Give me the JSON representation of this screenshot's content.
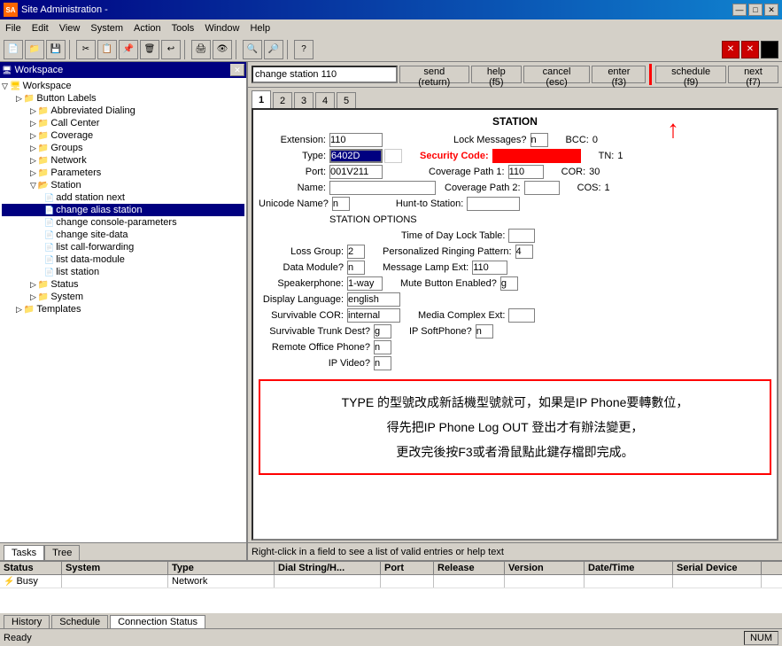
{
  "app": {
    "title": "Site Administration -",
    "icon": "SA"
  },
  "titlebar": {
    "minimize": "—",
    "maximize": "□",
    "close": "✕"
  },
  "menubar": {
    "items": [
      "File",
      "Edit",
      "View",
      "System",
      "Action",
      "Tools",
      "Window",
      "Help"
    ]
  },
  "inner_win": {
    "title": "",
    "close": "✕"
  },
  "workspace": {
    "title": "Workspace"
  },
  "tree": {
    "root": "Workspace",
    "items": [
      {
        "label": "Button Labels",
        "indent": 1,
        "type": "folder",
        "expanded": false
      },
      {
        "label": "Abbreviated Dialing",
        "indent": 2,
        "type": "folder",
        "expanded": false
      },
      {
        "label": "Call Center",
        "indent": 2,
        "type": "folder",
        "expanded": false
      },
      {
        "label": "Coverage",
        "indent": 2,
        "type": "folder",
        "expanded": false
      },
      {
        "label": "Groups",
        "indent": 2,
        "type": "folder",
        "expanded": false
      },
      {
        "label": "Network",
        "indent": 2,
        "type": "folder",
        "expanded": false
      },
      {
        "label": "Parameters",
        "indent": 2,
        "type": "folder",
        "expanded": false
      },
      {
        "label": "Station",
        "indent": 2,
        "type": "folder",
        "expanded": true
      },
      {
        "label": "add station next",
        "indent": 3,
        "type": "doc"
      },
      {
        "label": "change alias station",
        "indent": 3,
        "type": "doc"
      },
      {
        "label": "change console-parameters",
        "indent": 3,
        "type": "doc"
      },
      {
        "label": "change site-data",
        "indent": 3,
        "type": "doc"
      },
      {
        "label": "list call-forwarding",
        "indent": 3,
        "type": "doc"
      },
      {
        "label": "list data-module",
        "indent": 3,
        "type": "doc"
      },
      {
        "label": "list station",
        "indent": 3,
        "type": "doc"
      },
      {
        "label": "Status",
        "indent": 2,
        "type": "folder",
        "expanded": false
      },
      {
        "label": "System",
        "indent": 2,
        "type": "folder",
        "expanded": false
      },
      {
        "label": "Templates",
        "indent": 1,
        "type": "folder",
        "expanded": false
      }
    ]
  },
  "cmdbar": {
    "input_value": "change station 110",
    "send_label": "send (return)",
    "help_label": "help (f5)",
    "cancel_label": "cancel (esc)",
    "enter_label": "enter (f3)",
    "schedule_label": "schedule (f9)",
    "next_label": "next (f7)"
  },
  "tabs": {
    "pages": [
      "1",
      "2",
      "3",
      "4",
      "5"
    ],
    "active": "1"
  },
  "form": {
    "title": "STATION",
    "fields": {
      "extension_label": "Extension:",
      "extension_value": "110",
      "type_label": "Type:",
      "type_value": "6402D",
      "port_label": "Port:",
      "port_value": "001V211",
      "name_label": "Name:",
      "name_value": "",
      "unicode_label": "Unicode Name?",
      "unicode_value": "n",
      "lock_label": "Lock Messages?",
      "lock_value": "n",
      "security_label": "Security Code:",
      "security_value": "",
      "coverage1_label": "Coverage Path 1:",
      "coverage1_value": "110",
      "coverage2_label": "Coverage Path 2:",
      "coverage2_value": "",
      "hunt_label": "Hunt-to Station:",
      "hunt_value": "",
      "bcc_label": "BCC:",
      "bcc_value": "0",
      "tn_label": "TN:",
      "tn_value": "1",
      "cor_label": "COR:",
      "cor_value": "30",
      "cos_label": "COS:",
      "cos_value": "1",
      "section_label": "STATION OPTIONS",
      "tod_label": "Time of Day Lock Table:",
      "tod_value": "",
      "loss_label": "Loss Group:",
      "loss_value": "2",
      "personal_label": "Personalized Ringing Pattern:",
      "personal_value": "4",
      "data_label": "Data Module?",
      "data_value": "n",
      "msg_lamp_label": "Message Lamp Ext:",
      "msg_lamp_value": "110",
      "speaker_label": "Speakerphone:",
      "speaker_value": "1-way",
      "mute_label": "Mute Button Enabled?",
      "mute_value": "g",
      "display_label": "Display Language:",
      "display_value": "english",
      "survivable_cor_label": "Survivable COR:",
      "survivable_cor_value": "internal",
      "media_label": "Media Complex Ext:",
      "media_value": "",
      "survivable_trunk_label": "Survivable Trunk Dest?",
      "survivable_trunk_value": "g",
      "ip_softphone_label": "IP SoftPhone?",
      "ip_softphone_value": "n",
      "remote_label": "Remote Office Phone?",
      "remote_value": "n",
      "ip_video_label": "IP Video?",
      "ip_video_value": "n"
    }
  },
  "annotation": {
    "line1": "TYPE 的型號改成新話機型號就可，如果是IP Phone要轉數位，",
    "line2": "得先把IP Phone Log OUT 登出才有辦法變更，",
    "line3": "更改完後按F3或者滑鼠點此鍵存檔即完成。"
  },
  "status_hint": "Right-click in a field to see a list of valid entries or help text",
  "tasks_tabs": {
    "tasks": "Tasks",
    "tree": "Tree"
  },
  "log_table": {
    "headers": [
      "Status",
      "System",
      "Type",
      "Dial String/H...",
      "Port",
      "Release",
      "Version",
      "Date/Time",
      "Serial Device"
    ],
    "rows": [
      {
        "status": "Busy",
        "system": "",
        "type": "Network",
        "dial": "",
        "port": "",
        "release": "",
        "version": "",
        "datetime": "",
        "serial": ""
      }
    ]
  },
  "bottom_tabs": {
    "history": "History",
    "schedule": "Schedule",
    "connection_status": "Connection Status"
  },
  "status_bar": {
    "ready": "Ready",
    "num": "NUM"
  }
}
